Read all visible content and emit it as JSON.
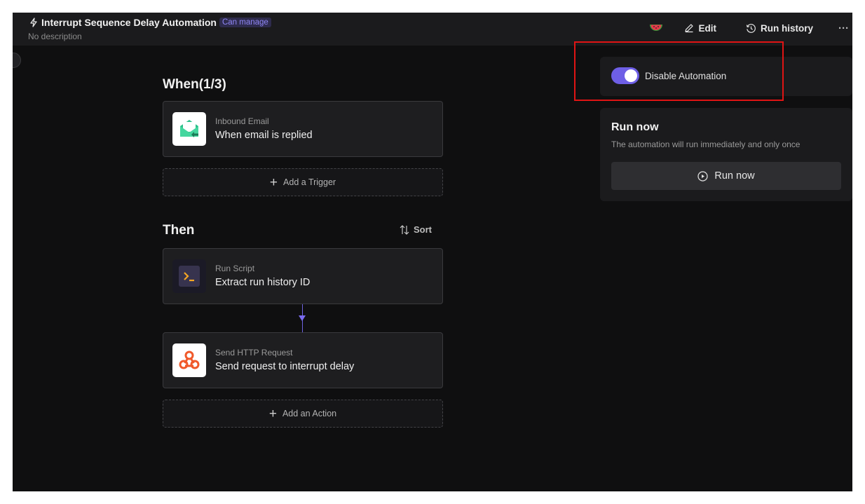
{
  "header": {
    "title": "Interrupt Sequence Delay Automation",
    "badge": "Can manage",
    "subtitle": "No description",
    "edit_label": "Edit",
    "run_history_label": "Run history",
    "more_label": "···"
  },
  "when": {
    "title": "When(1/3)",
    "trigger": {
      "kind": "Inbound Email",
      "name": "When email is replied"
    },
    "add_trigger_label": "Add a Trigger"
  },
  "then": {
    "title": "Then",
    "sort_label": "Sort",
    "actions": [
      {
        "kind": "Run Script",
        "name": "Extract run history ID"
      },
      {
        "kind": "Send HTTP Request",
        "name": "Send request to interrupt delay"
      }
    ],
    "add_action_label": "Add an Action"
  },
  "side": {
    "toggle_label": "Disable Automation",
    "toggle_on": true,
    "run_now_title": "Run now",
    "run_now_desc": "The automation will run immediately and only once",
    "run_now_button": "Run now"
  },
  "colors": {
    "accent": "#6e5fe6",
    "highlight": "#e01414",
    "email_icon": "#2bc08a",
    "http_icon": "#f0592a",
    "script_icon": "#f5a623"
  }
}
